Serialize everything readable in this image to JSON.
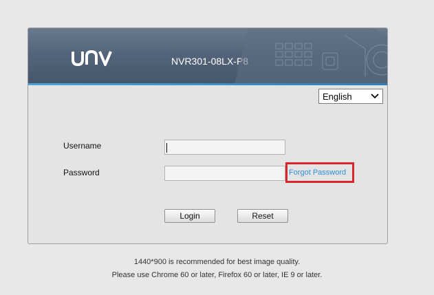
{
  "header": {
    "brand": "UNV",
    "model": "NVR301-08LX-P8"
  },
  "language": {
    "selected": "English"
  },
  "form": {
    "username_label": "Username",
    "username_value": "",
    "password_label": "Password",
    "password_value": "",
    "forgot_password": "Forgot Password",
    "login_label": "Login",
    "reset_label": "Reset"
  },
  "footer": {
    "line1": "1440*900 is recommended for best image quality.",
    "line2": "Please use Chrome 60 or later, Firefox 60 or later, IE 9 or later."
  },
  "colors": {
    "header_bg": "#54647a",
    "accent_line": "#3b8fc6",
    "link": "#2b8fd6",
    "highlight_box": "#d9262e"
  }
}
